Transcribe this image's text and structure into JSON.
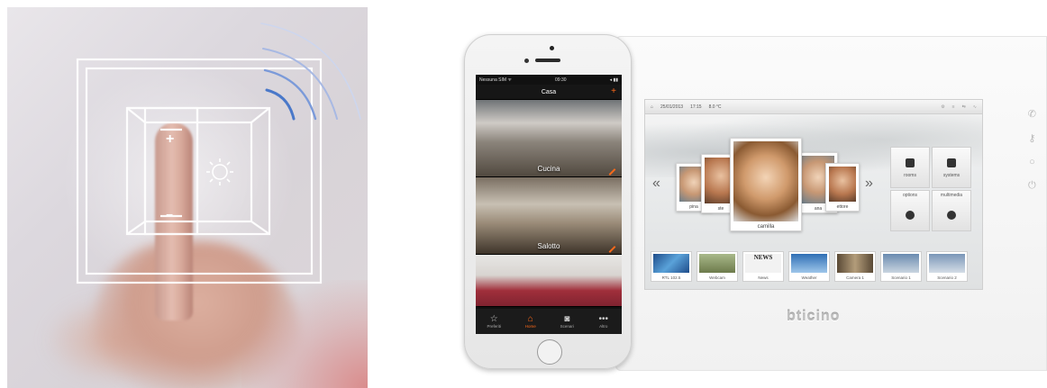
{
  "left_image": {
    "switch": {
      "plus_symbol": "+",
      "minus_symbol": "−",
      "sun_icon": "sun-icon"
    },
    "wireless_icon": "wireless-signal-icon"
  },
  "phone": {
    "status": {
      "carrier": "Nessuna SIM ᯤ",
      "time": "09:30",
      "battery": "◂ ▮▮"
    },
    "nav": {
      "title": "Casa",
      "add_symbol": "+"
    },
    "rooms": [
      {
        "label": "Cucina"
      },
      {
        "label": "Salotto"
      },
      {
        "label": ""
      }
    ],
    "tabs": [
      {
        "icon": "☆",
        "label": "Preferiti",
        "active": false
      },
      {
        "icon": "⌂",
        "label": "Home",
        "active": true
      },
      {
        "icon": "◙",
        "label": "Scenari",
        "active": false
      },
      {
        "icon": "•••",
        "label": "Altro",
        "active": false
      }
    ]
  },
  "panel": {
    "brand": "bticino",
    "topbar": {
      "home_icon": "⌂",
      "date": "25/01/2013",
      "time": "17:15",
      "temperature": "8.0 °C"
    },
    "nav_left": "«",
    "nav_right": "»",
    "contacts": [
      {
        "caption": "pina"
      },
      {
        "caption": "ste"
      },
      {
        "caption": "camilla"
      },
      {
        "caption": "ana"
      },
      {
        "caption": "ettore"
      }
    ],
    "menus": [
      {
        "label": "rooms"
      },
      {
        "label": "systems"
      },
      {
        "label": "options"
      },
      {
        "label": "multimedia"
      }
    ],
    "thumbnails": [
      {
        "caption": "RTL 102.5"
      },
      {
        "caption": "Webcam"
      },
      {
        "caption": "News",
        "img_text": "NEWS"
      },
      {
        "caption": "Weather"
      },
      {
        "caption": "Camera 1"
      },
      {
        "caption": "Scenario 1"
      },
      {
        "caption": "Scenario 2"
      }
    ],
    "side_icons": [
      "intercom-icon",
      "key-icon",
      "circle-icon",
      "power-icon"
    ]
  }
}
